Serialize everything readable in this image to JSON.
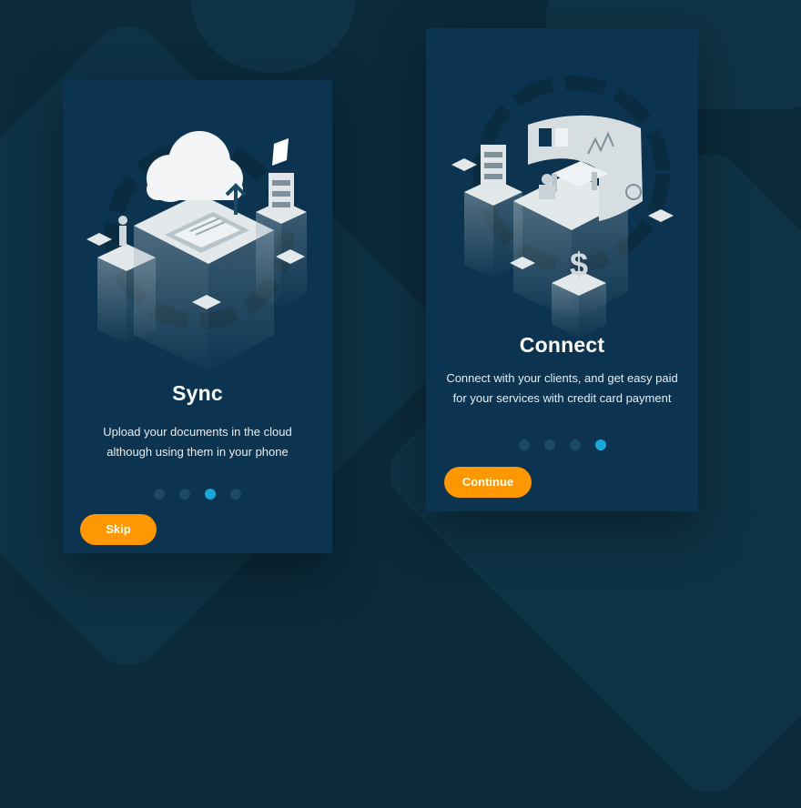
{
  "screens": [
    {
      "title": "Sync",
      "description_lines": [
        "Upload your documents in the cloud",
        "although using them in your phone"
      ],
      "active_dot": 3,
      "dot_count": 4,
      "button_label": "Skip",
      "illustration_icon": "cloud-sync-illustration-icon"
    },
    {
      "title": "Connect",
      "description_lines": [
        "Connect with your clients, and get easy paid",
        "for your services with credit card payment"
      ],
      "active_dot": 4,
      "dot_count": 4,
      "button_label": "Continue",
      "illustration_icon": "office-connect-illustration-icon"
    }
  ],
  "colors": {
    "background": "#0b2a3a",
    "card": "#0c3450",
    "accent": "#ff9800",
    "dot_active": "#1aa8d8",
    "dot_inactive": "#1c4a64"
  }
}
